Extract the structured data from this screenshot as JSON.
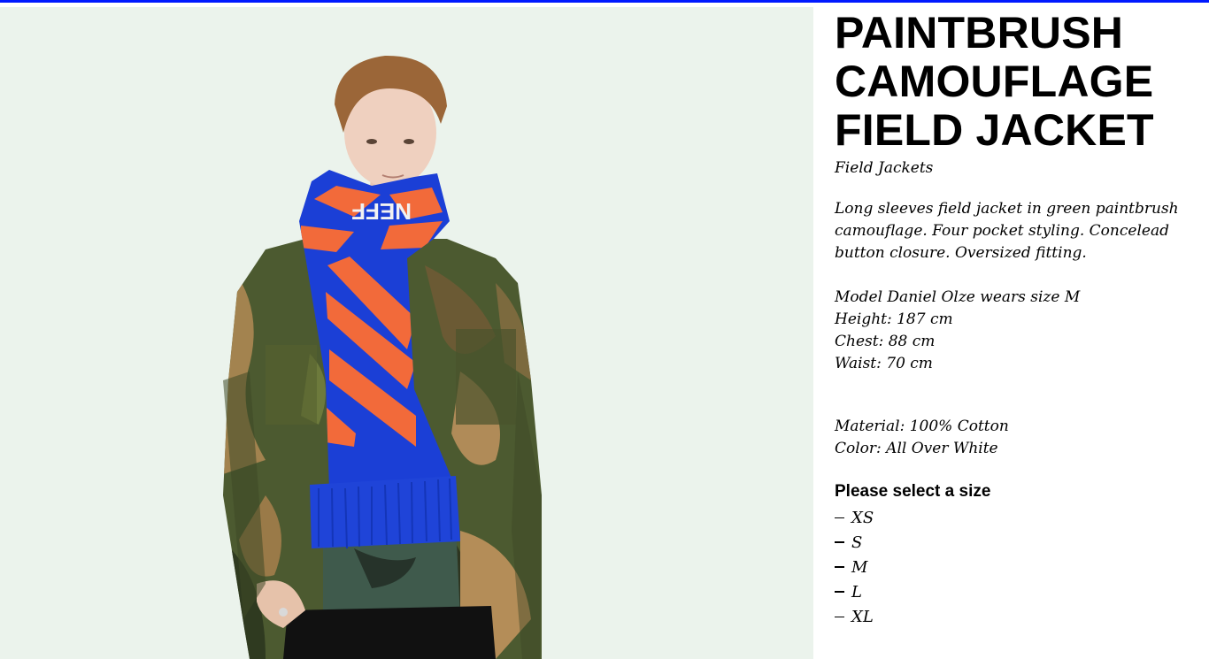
{
  "product": {
    "title_lines": [
      "PAINTBRUSH",
      "CAMOUFLAGE",
      "FIELD JACKET"
    ],
    "category": "Field Jackets",
    "description": "Long sleeves field jacket in green paintbrush camouflage. Four pocket styling. Concelead button closure. Oversized fitting.",
    "model_info": [
      "Model Daniel Olze wears size M",
      "Height: 187 cm",
      "Chest: 88 cm",
      "Waist: 70 cm"
    ],
    "material": "Material: 100% Cotton",
    "color": "Color: All Over White"
  },
  "size_selector": {
    "heading": "Please select a size",
    "options": [
      "XS",
      "S",
      "M",
      "L",
      "XL"
    ]
  },
  "colors": {
    "accent_bar": "#0019ff",
    "photo_background": "#ebf3ec",
    "scarf_blue": "#1b3fd6",
    "scarf_orange": "#f26a3a"
  }
}
